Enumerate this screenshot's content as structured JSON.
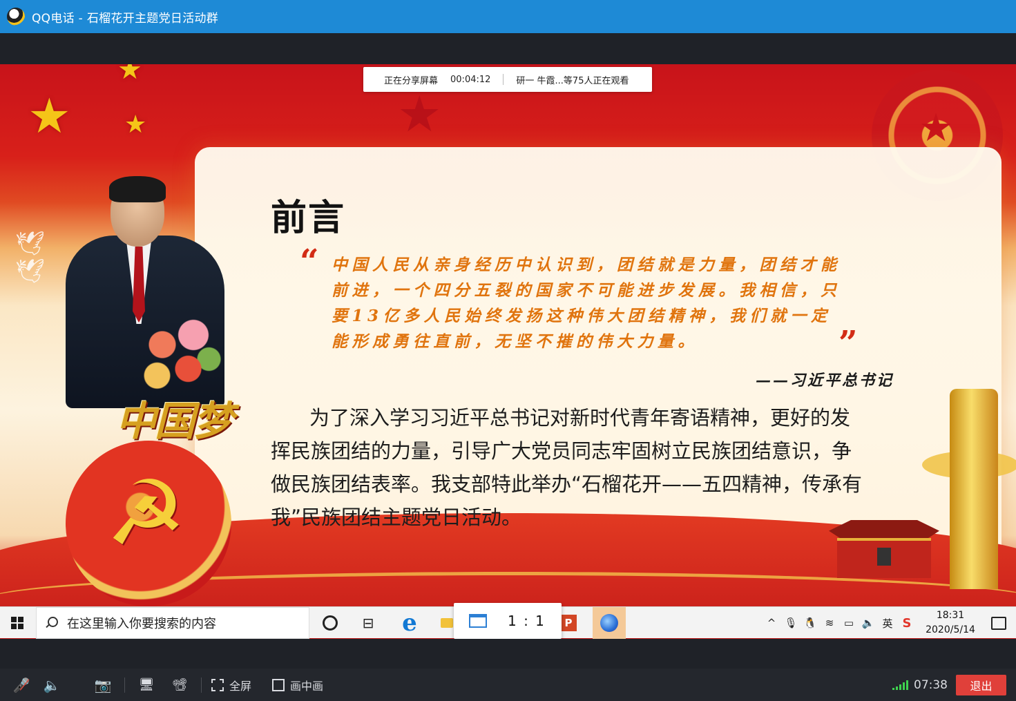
{
  "window": {
    "app_name": "QQ电话",
    "separator": " - ",
    "group_name": "石榴花开主题党日活动群"
  },
  "share_banner": {
    "status": "正在分享屏幕",
    "elapsed": "00:04:12",
    "viewers": "研一 牛霞...等75人正在观看"
  },
  "slide": {
    "heading": "前言",
    "quote_open": "“",
    "quote_close": "”",
    "quote": "中国人民从亲身经历中认识到，团结就是力量，团结才能前进，一个四分五裂的国家不可能进步发展。我相信，只要13亿多人民始终发扬这种伟大团结精神，我们就一定能形成勇往直前，无坚不摧的伟大力量。",
    "attribution": "——习近平总书记",
    "body": "为了深入学习习近平总书记对新时代青年寄语精神，更好的发挥民族团结的力量，引导广大党员同志牢固树立民族团结意识，争做民族团结表率。我支部特此举办“石榴花开——五四精神，传承有我”民族团结主题党日活动。",
    "emblem_text": "中国梦"
  },
  "taskbar": {
    "search_placeholder": "在这里输入你要搜索的内容",
    "ratio_label": "1 : 1",
    "time": "18:31",
    "date": "2020/5/14",
    "ime_label": "英"
  },
  "controls": {
    "fullscreen_label": "全屏",
    "pip_label": "画中画",
    "duration": "07:38",
    "exit_label": "退出"
  },
  "colors": {
    "titlebar": "#1e8ad6",
    "quote_text": "#e0740e",
    "exit_button": "#e0403a",
    "signal": "#3ed34f"
  }
}
